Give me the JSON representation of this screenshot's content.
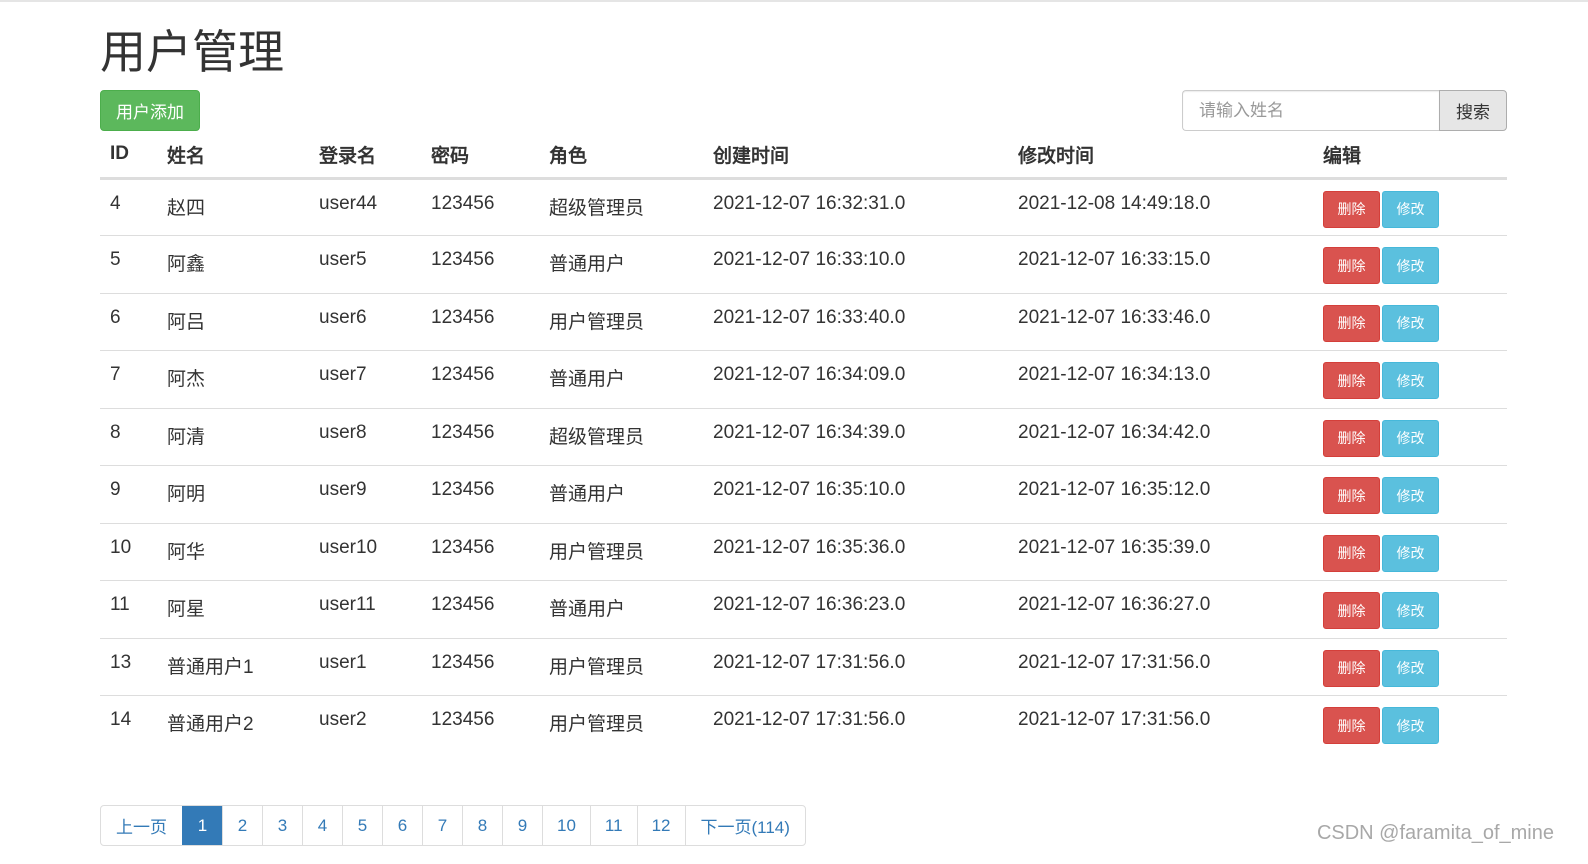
{
  "header": {
    "title": "用户管理",
    "add_button": "用户添加"
  },
  "search": {
    "placeholder": "请输入姓名",
    "value": "",
    "button": "搜索"
  },
  "table": {
    "columns": [
      "ID",
      "姓名",
      "登录名",
      "密码",
      "角色",
      "创建时间",
      "修改时间",
      "编辑"
    ],
    "delete_label": "删除",
    "edit_label": "修改",
    "rows": [
      {
        "id": "4",
        "name": "赵四",
        "login": "user44",
        "password": "123456",
        "role": "超级管理员",
        "created": "2021-12-07 16:32:31.0",
        "modified": "2021-12-08 14:49:18.0"
      },
      {
        "id": "5",
        "name": "阿鑫",
        "login": "user5",
        "password": "123456",
        "role": "普通用户",
        "created": "2021-12-07 16:33:10.0",
        "modified": "2021-12-07 16:33:15.0"
      },
      {
        "id": "6",
        "name": "阿吕",
        "login": "user6",
        "password": "123456",
        "role": "用户管理员",
        "created": "2021-12-07 16:33:40.0",
        "modified": "2021-12-07 16:33:46.0"
      },
      {
        "id": "7",
        "name": "阿杰",
        "login": "user7",
        "password": "123456",
        "role": "普通用户",
        "created": "2021-12-07 16:34:09.0",
        "modified": "2021-12-07 16:34:13.0"
      },
      {
        "id": "8",
        "name": "阿清",
        "login": "user8",
        "password": "123456",
        "role": "超级管理员",
        "created": "2021-12-07 16:34:39.0",
        "modified": "2021-12-07 16:34:42.0"
      },
      {
        "id": "9",
        "name": "阿明",
        "login": "user9",
        "password": "123456",
        "role": "普通用户",
        "created": "2021-12-07 16:35:10.0",
        "modified": "2021-12-07 16:35:12.0"
      },
      {
        "id": "10",
        "name": "阿华",
        "login": "user10",
        "password": "123456",
        "role": "用户管理员",
        "created": "2021-12-07 16:35:36.0",
        "modified": "2021-12-07 16:35:39.0"
      },
      {
        "id": "11",
        "name": "阿星",
        "login": "user11",
        "password": "123456",
        "role": "普通用户",
        "created": "2021-12-07 16:36:23.0",
        "modified": "2021-12-07 16:36:27.0"
      },
      {
        "id": "13",
        "name": "普通用户1",
        "login": "user1",
        "password": "123456",
        "role": "用户管理员",
        "created": "2021-12-07 17:31:56.0",
        "modified": "2021-12-07 17:31:56.0"
      },
      {
        "id": "14",
        "name": "普通用户2",
        "login": "user2",
        "password": "123456",
        "role": "用户管理员",
        "created": "2021-12-07 17:31:56.0",
        "modified": "2021-12-07 17:31:56.0"
      }
    ]
  },
  "pagination": {
    "prev": "上一页",
    "pages": [
      "1",
      "2",
      "3",
      "4",
      "5",
      "6",
      "7",
      "8",
      "9",
      "10",
      "11",
      "12"
    ],
    "current": "1",
    "next": "下一页(114)"
  },
  "watermark": "CSDN @faramita_of_mine",
  "colors": {
    "success": "#5cb85c",
    "danger": "#d9534f",
    "info": "#5bc0de",
    "primary": "#337ab7"
  }
}
